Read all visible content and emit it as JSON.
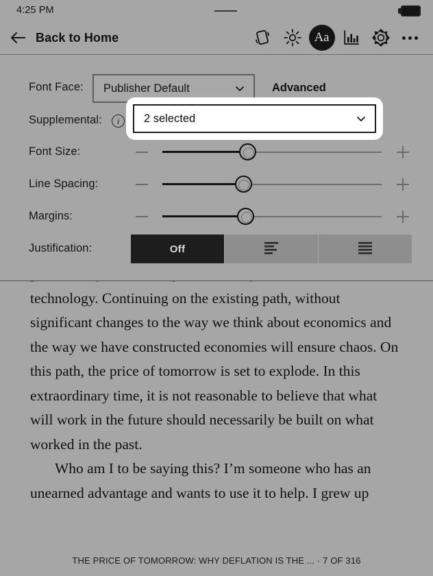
{
  "status": {
    "time": "4:25 PM",
    "battery_icon": "battery-full-icon",
    "handle_icon": "drag-handle-icon"
  },
  "toolbar": {
    "back_icon": "back-arrow-icon",
    "back_label": "Back to Home",
    "icons": [
      {
        "name": "rotation-lock-icon",
        "label": "Rotation"
      },
      {
        "name": "brightness-icon",
        "label": "Brightness"
      },
      {
        "name": "font-aa-icon",
        "label": "Aa",
        "active": true
      },
      {
        "name": "reading-stats-icon",
        "label": "Reading Stats"
      },
      {
        "name": "settings-gear-icon",
        "label": "Settings"
      },
      {
        "name": "more-options-icon",
        "label": "More"
      }
    ]
  },
  "panel": {
    "font_face": {
      "label": "Font Face:",
      "value": "Publisher Default",
      "chevron_icon": "chevron-down-icon"
    },
    "advanced_label": "Advanced",
    "supplemental": {
      "label": "Supplemental:",
      "info_icon": "info-icon",
      "info_glyph": "i",
      "value": "2 selected",
      "chevron_icon": "chevron-down-icon",
      "focused": true
    },
    "sliders": [
      {
        "label": "Font Size:",
        "minus_icon": "minus-icon",
        "plus_icon": "plus-icon",
        "percent": 39
      },
      {
        "label": "Line Spacing:",
        "minus_icon": "minus-icon",
        "plus_icon": "plus-icon",
        "percent": 37
      },
      {
        "label": "Margins:",
        "minus_icon": "minus-icon",
        "plus_icon": "plus-icon",
        "percent": 38
      }
    ],
    "justification": {
      "label": "Justification:",
      "options": [
        {
          "label": "Off",
          "icon": "text-off-icon",
          "active": true
        },
        {
          "label": "",
          "icon": "align-left-icon",
          "active": false
        },
        {
          "label": "",
          "icon": "align-justify-icon",
          "active": false
        }
      ]
    }
  },
  "book": {
    "paragraphs": [
      "pretend they are working because they did in an era before technology. Continuing on the existing path, without significant changes to the way we think about economics and the way we have constructed economies will ensure chaos. On this path, the price of tomorrow is set to explode. In this extraordinary time, it is not reasonable to believe that what will work in the future should necessarily be built on what worked in the past.",
      "Who am I to be saying this? I’m someone who has an unearned advantage and wants to use it to help. I grew up"
    ],
    "footer": "THE PRICE OF TOMORROW: WHY DEFLATION IS THE ... · 7 OF 316"
  },
  "colors": {
    "background": "#a6a6a6",
    "panel_background": "#a6a6a6",
    "text": "#111111",
    "active_segment": "#1d1d1d",
    "inactive_segment": "#8e8e8e",
    "highlight": "#ffffff"
  }
}
